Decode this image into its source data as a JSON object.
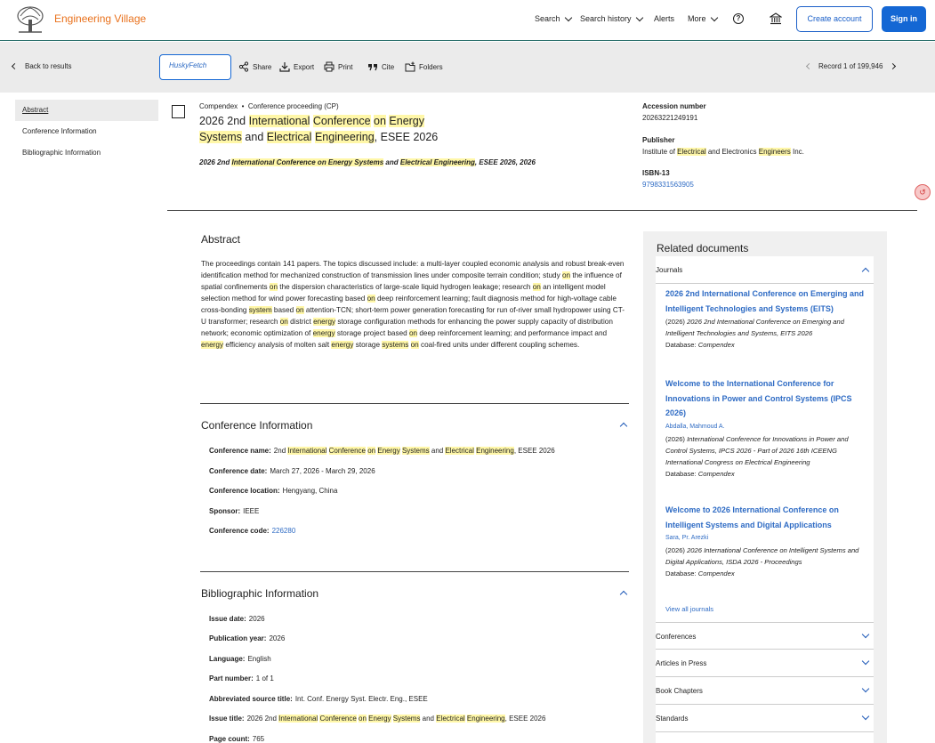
{
  "header": {
    "brand": "Engineering Village",
    "nav": {
      "search": "Search",
      "search_history": "Search history",
      "alerts": "Alerts",
      "more": "More"
    },
    "help_glyph": "?",
    "create_account": "Create account",
    "sign_in": "Sign in"
  },
  "toolbar": {
    "back": "Back to results",
    "husky": "HuskyFetch",
    "share": "Share",
    "export": "Export",
    "print": "Print",
    "cite": "Cite",
    "folders": "Folders",
    "record": "Record 1 of 199,946"
  },
  "leftnav": [
    "Abstract",
    "Conference Information",
    "Bibliographic Information"
  ],
  "doc": {
    "database": "Compendex",
    "doctype": "Conference proceeding (CP)",
    "title_parts": [
      "2026 2nd ",
      "International",
      " ",
      "Conference",
      " ",
      "on",
      " ",
      "Energy",
      " ",
      "Systems",
      " and ",
      "Electrical",
      " ",
      "Engineering",
      ", ESEE 2026"
    ],
    "source_parts": [
      "2026 2nd ",
      "International Conference on Energy Systems",
      " and ",
      "Electrical Engineering",
      ", ESEE 2026, 2026"
    ],
    "accession_label": "Accession number",
    "accession": "20263221249191",
    "publisher_label": "Publisher",
    "publisher_parts": [
      "Institute of ",
      "Electrical",
      " and Electronics ",
      "Engineers",
      " Inc."
    ],
    "isbn_label": "ISBN-13",
    "isbn": "9798331563905"
  },
  "abstract": {
    "title": "Abstract",
    "text_parts": [
      "The proceedings contain 141 papers. The topics discussed include: a multi-layer coupled economic analysis and robust break-even identification method for mechanized construction of transmission lines under composite terrain condition; study ",
      "on",
      " the influence of spatial confinements ",
      "on",
      " the dispersion characteristics of large-scale liquid hydrogen leakage; research ",
      "on",
      " an intelligent model selection method for wind power forecasting based ",
      "on",
      " deep reinforcement learning; fault diagnosis method for high-voltage cable cross-bonding ",
      "system",
      " based ",
      "on",
      " attention-TCN; short-term power generation forecasting for run of-river small hydropower using CT-U transformer; research ",
      "on",
      " district ",
      "energy",
      " storage configuration methods for enhancing the power supply capacity of distribution network; economic optimization of ",
      "energy",
      " storage project based ",
      "on",
      " deep reinforcement learning; and performance impact and ",
      "energy",
      " efficiency analysis of molten salt ",
      "energy",
      " storage ",
      "systems",
      " ",
      "on",
      " coal-fired units under different coupling schemes."
    ]
  },
  "conference": {
    "title": "Conference Information",
    "name_label": "Conference name:",
    "name_parts": [
      "2nd ",
      "International",
      " ",
      "Conference",
      " ",
      "on",
      " ",
      "Energy",
      " ",
      "Systems",
      " and ",
      "Electrical",
      " ",
      "Engineering",
      ", ESEE 2026"
    ],
    "date_label": "Conference date:",
    "date": "March 27, 2026 - March 29, 2026",
    "location_label": "Conference location:",
    "location": "Hengyang, China",
    "sponsor_label": "Sponsor:",
    "sponsor": "IEEE",
    "code_label": "Conference code:",
    "code": "226280"
  },
  "biblio": {
    "title": "Bibliographic Information",
    "issue_date_label": "Issue date:",
    "issue_date": "2026",
    "pub_year_label": "Publication year:",
    "pub_year": "2026",
    "language_label": "Language:",
    "language": "English",
    "part_label": "Part number:",
    "part": "1 of 1",
    "abbr_label": "Abbreviated source title:",
    "abbr": "Int. Conf. Energy Syst. Electr. Eng., ESEE",
    "issue_title_label": "Issue title:",
    "issue_title_parts": [
      "2026 2nd ",
      "International",
      " ",
      "Conference",
      " ",
      "on",
      " ",
      "Energy",
      " ",
      "Systems",
      " and ",
      "Electrical",
      " ",
      "Engineering",
      ", ESEE 2026"
    ],
    "page_count_label": "Page count:",
    "page_count": "765"
  },
  "related": {
    "title": "Related documents",
    "journals_label": "Journals",
    "items": [
      {
        "title": "2026 2nd International Conference on Emerging and Intelligent Technologies and Systems (EITS)",
        "author": "",
        "year": "(2026) ",
        "source": "2026 2nd International Conference on Emerging and Intelligent Technologies and Systems, EITS 2026",
        "db": "Database: ",
        "db_name": "Compendex"
      },
      {
        "title": "Welcome to the International Conference for Innovations in Power and Control Systems (IPCS 2026)",
        "author": "Abdalla, Mahmoud A.",
        "year": "(2026) ",
        "source": "International Conference for Innovations in Power and Control Systems, IPCS 2026 - Part of 2026 16th ICEENG International Congress on Electrical Engineering",
        "db": "Database: ",
        "db_name": "Compendex"
      },
      {
        "title": "Welcome to 2026 International Conference on Intelligent Systems and Digital Applications",
        "author": "Sara, Pr. Arezki",
        "year": "(2026) ",
        "source": "2026 International Conference on Intelligent Systems and Digital Applications, ISDA 2026 - Proceedings",
        "db": "Database: ",
        "db_name": "Compendex"
      }
    ],
    "view_all": "View all journals",
    "categories": [
      "Conferences",
      "Articles in Press",
      "Book Chapters",
      "Standards"
    ]
  },
  "colors": {
    "brand": "#e9711c",
    "primary": "#1467d4",
    "link": "#2e6bc4",
    "highlight": "#fff7a8"
  }
}
